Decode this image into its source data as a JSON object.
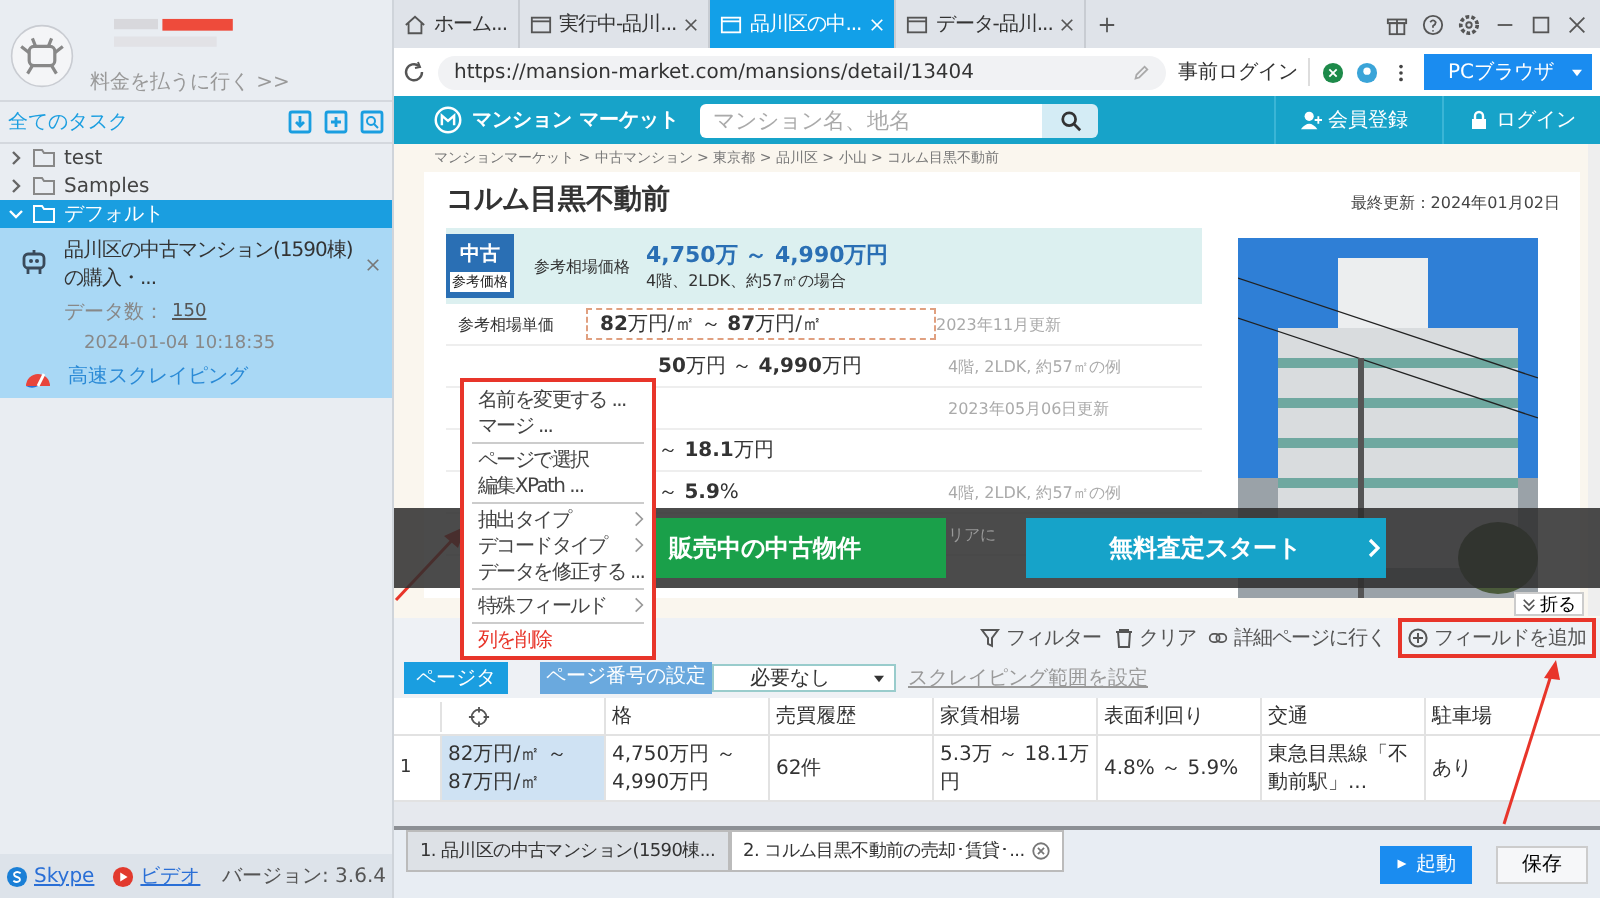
{
  "sidebar": {
    "account_link": "料金を払うに行く >>",
    "section_title": "全てのタスク",
    "tree": [
      {
        "label": "test",
        "expanded": false,
        "selected": false
      },
      {
        "label": "Samples",
        "expanded": false,
        "selected": false
      },
      {
        "label": "デフォルト",
        "expanded": true,
        "selected": true,
        "children": [
          {
            "title": "品川区の中古マンション(1590棟)の購入・...",
            "count_label": "データ数：",
            "count": "150",
            "time": "2024-01-04 10:18:35",
            "mode": "高速スクレイピング",
            "selected": true
          }
        ]
      }
    ],
    "footer_links": [
      {
        "kind": "skype",
        "label": "Skype"
      },
      {
        "kind": "video",
        "label": "ビデオ"
      }
    ],
    "version": "バージョン: 3.6.4"
  },
  "browser": {
    "tabs": [
      {
        "kind": "home",
        "label": "ホーム...",
        "selected": false,
        "closable": false
      },
      {
        "kind": "page",
        "label": "実行中-品川...",
        "selected": false,
        "closable": true
      },
      {
        "kind": "page",
        "label": "品川区の中...",
        "selected": true,
        "closable": true
      },
      {
        "kind": "page",
        "label": "データ-品川...",
        "selected": false,
        "closable": true
      }
    ],
    "url": "https://mansion-market.com/mansions/detail/13404",
    "prelogin": "事前ログイン",
    "mode_button": "PCブラウザ"
  },
  "site": {
    "logo": "マンション マーケット",
    "search_placeholder": "マンション名、地名",
    "nav": [
      {
        "kind": "user",
        "label": "会員登録"
      },
      {
        "kind": "lock",
        "label": "ログイン"
      }
    ],
    "breadcrumb": "マンションマーケット > 中古マンション > 東京都 > 品川区 > 小山 > コルム目黒不動前",
    "title": "コルム目黒不動前",
    "updated": "最終更新：2024年01月02日",
    "price": {
      "badge": "中古",
      "badge_sub": "参考価格",
      "label": "参考相場価格",
      "value": "4,750万 ～ 4,990万円",
      "note": "4階、2LDK、約57㎡の場合"
    },
    "rows": [
      {
        "kind": "full",
        "label": "参考相場単価",
        "value": "**82**万円/㎡ ～ **87**万円/㎡",
        "note": "2023年11月更新",
        "selected": true
      },
      {
        "kind": "covered",
        "value": "**50**万円 ～ **4,990**万円",
        "note": "4階, 2LDK, 約57㎡の例",
        "selected": false
      },
      {
        "kind": "covered",
        "note": "2023年05月06日更新",
        "selected": false
      },
      {
        "kind": "covered",
        "value": "～ **18.1**万円",
        "selected": false
      },
      {
        "kind": "covered",
        "value": "～ **5.9**%",
        "note": "4階, 2LDK, 約57㎡の例",
        "selected": false
      },
      {
        "kind": "covered",
        "note": "リアに",
        "selected": false
      }
    ],
    "banner": [
      "販売中の中古物件",
      "無料査定スタート"
    ],
    "collapse": "折る"
  },
  "context_menu": [
    {
      "kind": "item",
      "label": "名前を変更する ..."
    },
    {
      "kind": "item",
      "label": "マージ ..."
    },
    {
      "kind": "item",
      "label": "ページで選択",
      "separator_before": true
    },
    {
      "kind": "item",
      "label": "編集XPath ..."
    },
    {
      "kind": "submenu",
      "label": "抽出タイプ",
      "separator_before": true
    },
    {
      "kind": "submenu",
      "label": "デコードタイプ"
    },
    {
      "kind": "item",
      "label": "データを修正する ..."
    },
    {
      "kind": "submenu",
      "label": "特殊フィールド",
      "separator_before": true
    },
    {
      "kind": "danger",
      "label": "列を削除",
      "separator_before": true
    }
  ],
  "panel": {
    "toolbar": {
      "tab_button": "ページタ",
      "page_setting": "ページ番号の設定",
      "page_select": "必要なし",
      "range_link": "スクレイピング範囲を設定",
      "actions": [
        {
          "kind": "filter",
          "label": "フィルター"
        },
        {
          "kind": "trash",
          "label": "クリア"
        },
        {
          "kind": "link",
          "label": "詳細ページに行く"
        },
        {
          "kind": "add",
          "label": "フィールドを追加"
        }
      ]
    },
    "columns": [
      {
        "kind": "icon"
      },
      {
        "kind": "text",
        "label": "格"
      },
      {
        "kind": "text",
        "label": "売買履歴"
      },
      {
        "kind": "text",
        "label": "家賃相場"
      },
      {
        "kind": "text",
        "label": "表面利回り"
      },
      {
        "kind": "text",
        "label": "交通"
      },
      {
        "kind": "text",
        "label": "駐車場"
      }
    ],
    "rows": [
      {
        "index": "1",
        "cells": [
          {
            "text": "82万円/㎡ ～ 87万円/㎡",
            "selected": true
          },
          {
            "text": "4,750万円 ～ 4,990万円",
            "selected": false
          },
          {
            "text": "62件",
            "selected": false
          },
          {
            "text": "5.3万 ～ 18.1万円",
            "selected": false
          },
          {
            "text": "4.8% ～ 5.9%",
            "selected": false
          },
          {
            "text": "東急目黒線「不動前駅」...",
            "selected": false
          },
          {
            "text": "あり",
            "selected": false
          }
        ]
      }
    ]
  },
  "bottom_tabs": [
    {
      "label": "1. 品川区の中古マンション(1590棟...",
      "selected": false
    },
    {
      "label": "2. コルム目黒不動前の売却･賃貸･...",
      "selected": true
    }
  ],
  "run_button": "起動",
  "save_button": "保存"
}
